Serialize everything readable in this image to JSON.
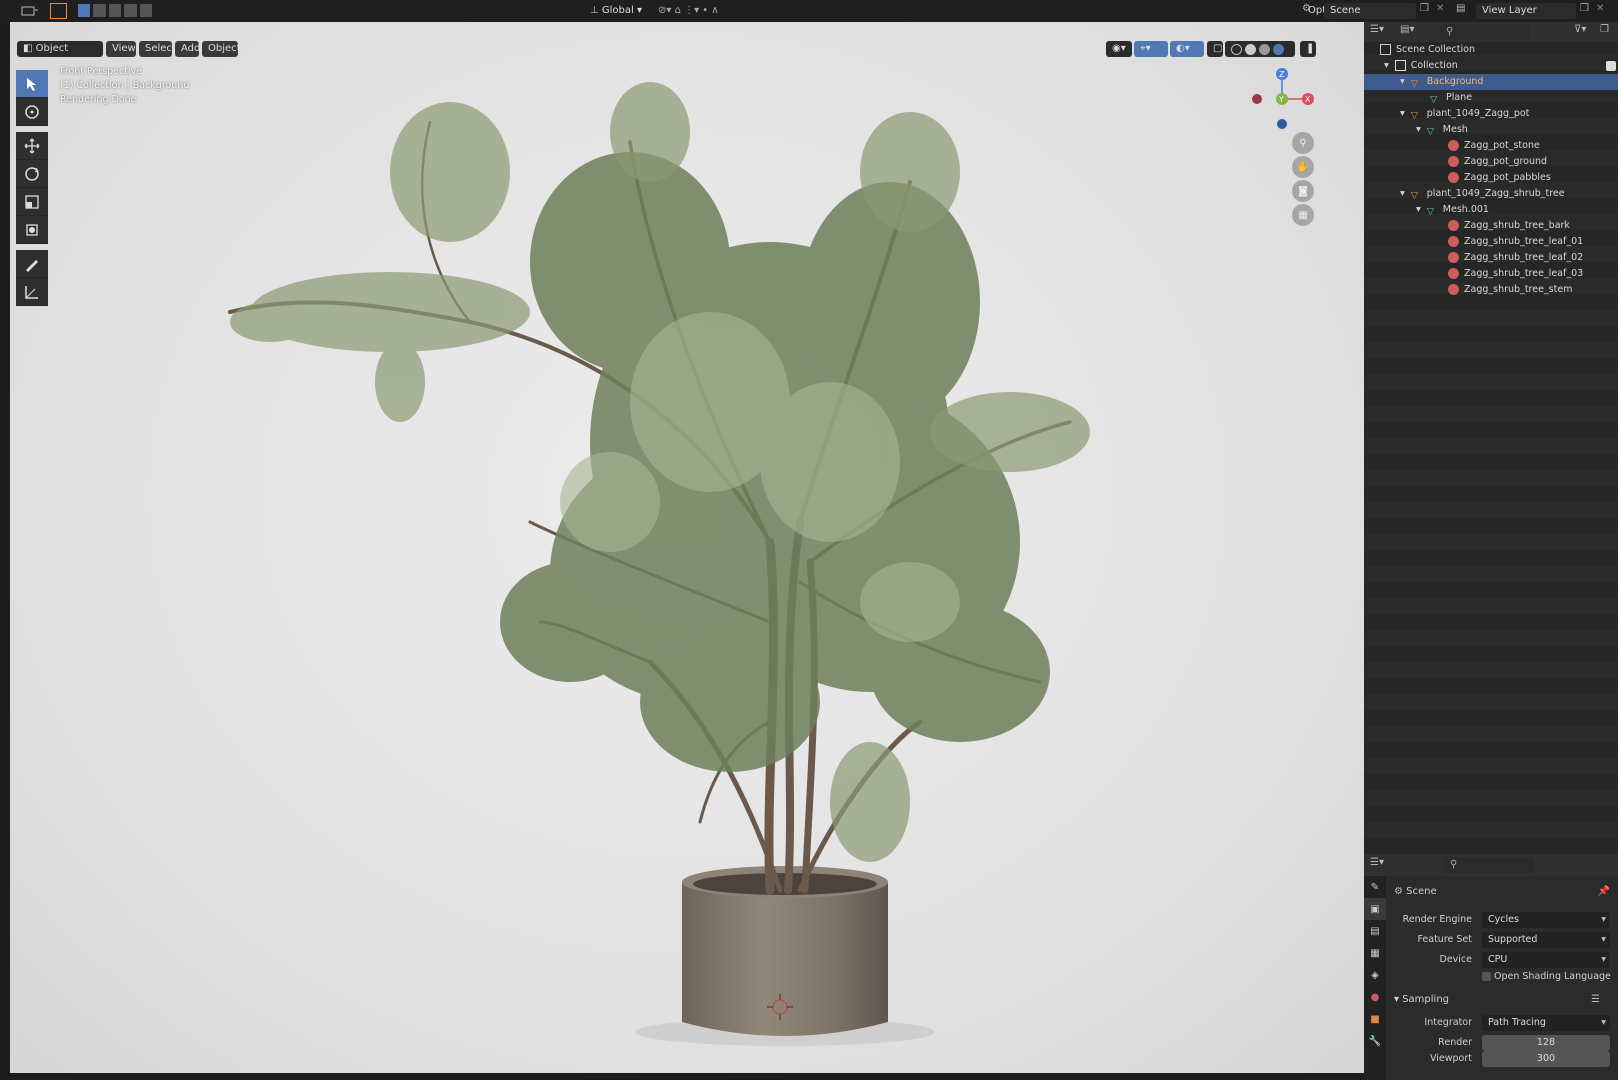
{
  "topbar": {
    "options_label": "Options",
    "transform_orientation": "Global",
    "scene_name": "Scene",
    "view_layer": "View Layer"
  },
  "viewport": {
    "mode": "Object Mode",
    "menus": [
      "View",
      "Select",
      "Add",
      "Object"
    ],
    "info_line1": "Front Perspective",
    "info_line2": "(1) Collection | Background",
    "info_line3": "Rendering Done",
    "gizmo": {
      "z": "Z",
      "y": "Y",
      "x": "X"
    }
  },
  "outliner": {
    "scene_collection": "Scene Collection",
    "items": [
      {
        "label": "Collection",
        "type": "collection"
      },
      {
        "label": "Background",
        "type": "object",
        "selected": true
      },
      {
        "label": "Plane",
        "type": "mesh"
      },
      {
        "label": "plant_1049_Zagg_pot",
        "type": "object"
      },
      {
        "label": "Mesh",
        "type": "mesh"
      },
      {
        "label": "Zagg_pot_stone",
        "type": "material"
      },
      {
        "label": "Zagg_pot_ground",
        "type": "material"
      },
      {
        "label": "Zagg_pot_pabbles",
        "type": "material"
      },
      {
        "label": "plant_1049_Zagg_shrub_tree",
        "type": "object"
      },
      {
        "label": "Mesh.001",
        "type": "mesh"
      },
      {
        "label": "Zagg_shrub_tree_bark",
        "type": "material"
      },
      {
        "label": "Zagg_shrub_tree_leaf_01",
        "type": "material"
      },
      {
        "label": "Zagg_shrub_tree_leaf_02",
        "type": "material"
      },
      {
        "label": "Zagg_shrub_tree_leaf_03",
        "type": "material"
      },
      {
        "label": "Zagg_shrub_tree_stem",
        "type": "material"
      }
    ]
  },
  "properties": {
    "context": "Scene",
    "render_engine_label": "Render Engine",
    "render_engine": "Cycles",
    "feature_set_label": "Feature Set",
    "feature_set": "Supported",
    "device_label": "Device",
    "device": "CPU",
    "osl_label": "Open Shading Language",
    "sampling_label": "Sampling",
    "integrator_label": "Integrator",
    "integrator": "Path Tracing",
    "render_label": "Render",
    "render_samples": "128",
    "viewport_label": "Viewport",
    "viewport_samples": "300"
  },
  "colors": {
    "accent": "#5078b4",
    "selection": "#3f5a8c",
    "object_orange": "#e8883a",
    "mesh_green": "#4ec9a0",
    "material_red": "#d25a5a"
  }
}
